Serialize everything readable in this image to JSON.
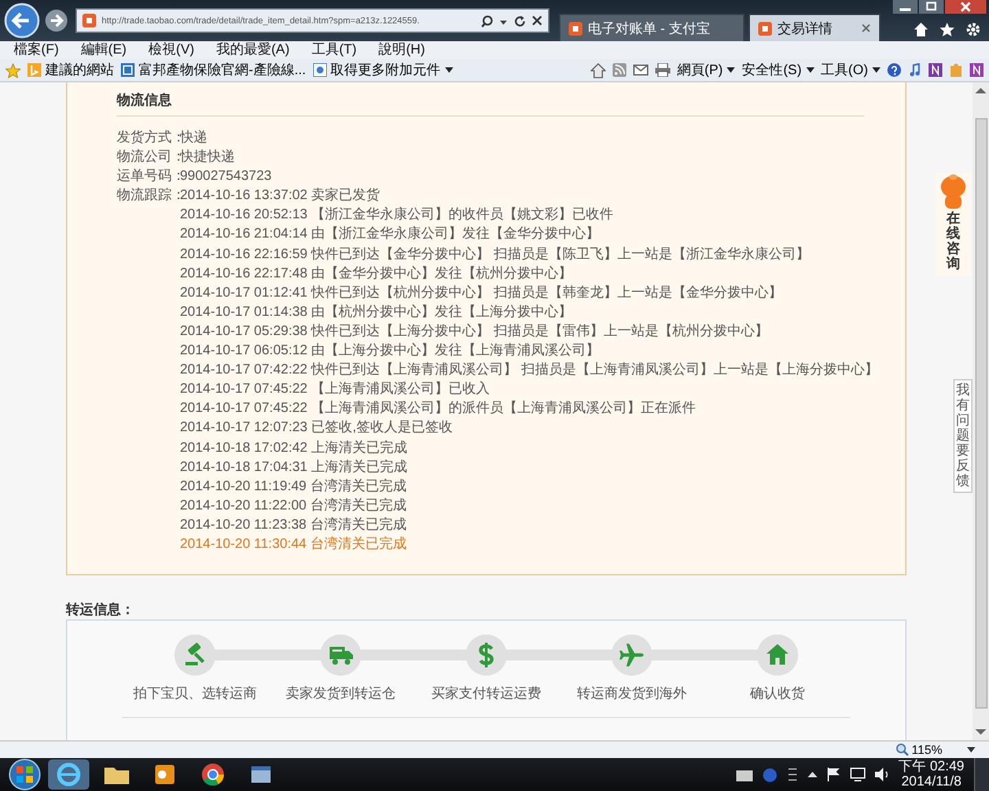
{
  "browser": {
    "address": "http://trade.taobao.com/trade/detail/trade_item_detail.htm?spm=a213z.1224559.",
    "tabs": [
      {
        "title": "电子对账单 - 支付宝",
        "selected": false
      },
      {
        "title": "交易详情",
        "selected": true
      }
    ],
    "menu": [
      "檔案(F)",
      "編輯(E)",
      "檢視(V)",
      "我的最愛(A)",
      "工具(T)",
      "說明(H)"
    ],
    "favorites": [
      "建議的網站",
      "富邦產物保險官網-產險線...",
      "取得更多附加元件"
    ],
    "commands": [
      "網頁(P)",
      "安全性(S)",
      "工具(O)"
    ]
  },
  "logistics": {
    "title": "物流信息",
    "fields": [
      {
        "label": "发货方式：",
        "value": "快递"
      },
      {
        "label": "物流公司：",
        "value": "快捷快递"
      },
      {
        "label": "运单号码：",
        "value": "990027543723"
      }
    ],
    "tracking_label": "物流跟踪：",
    "events": [
      {
        "text": "2014-10-16 13:37:02 卖家已发货",
        "latest": false
      },
      {
        "text": "2014-10-16 20:52:13 【浙江金华永康公司】的收件员【姚文彩】已收件",
        "latest": false
      },
      {
        "text": "2014-10-16 21:04:14 由【浙江金华永康公司】发往【金华分拨中心】",
        "latest": false
      },
      {
        "text": "2014-10-16 22:16:59 快件已到达【金华分拨中心】 扫描员是【陈卫飞】上一站是【浙江金华永康公司】",
        "latest": false
      },
      {
        "text": "2014-10-16 22:17:48 由【金华分拨中心】发往【杭州分拨中心】",
        "latest": false
      },
      {
        "text": "2014-10-17 01:12:41 快件已到达【杭州分拨中心】 扫描员是【韩奎龙】上一站是【金华分拨中心】",
        "latest": false
      },
      {
        "text": "2014-10-17 01:14:38 由【杭州分拨中心】发往【上海分拨中心】",
        "latest": false
      },
      {
        "text": "2014-10-17 05:29:38 快件已到达【上海分拨中心】 扫描员是【雷伟】上一站是【杭州分拨中心】",
        "latest": false
      },
      {
        "text": "2014-10-17 06:05:12 由【上海分拨中心】发往【上海青浦凤溪公司】",
        "latest": false
      },
      {
        "text": "2014-10-17 07:42:22 快件已到达【上海青浦凤溪公司】 扫描员是【上海青浦凤溪公司】上一站是【上海分拨中心】",
        "latest": false
      },
      {
        "text": "2014-10-17 07:45:22 【上海青浦凤溪公司】已收入",
        "latest": false
      },
      {
        "text": "2014-10-17 07:45:22 【上海青浦凤溪公司】的派件员【上海青浦凤溪公司】正在派件",
        "latest": false
      },
      {
        "text": "2014-10-17 12:07:23 已签收,签收人是已签收",
        "latest": false
      },
      {
        "text": "2014-10-18 17:02:42 上海清关已完成",
        "latest": false
      },
      {
        "text": "2014-10-18 17:04:31 上海清关已完成",
        "latest": false
      },
      {
        "text": "2014-10-20 11:19:49 台湾清关已完成",
        "latest": false
      },
      {
        "text": "2014-10-20 11:22:00 台湾清关已完成",
        "latest": false
      },
      {
        "text": "2014-10-20 11:23:38 台湾清关已完成",
        "latest": false
      },
      {
        "text": "2014-10-20 11:30:44 台湾清关已完成",
        "latest": true
      }
    ]
  },
  "transfer": {
    "title": "转运信息：",
    "steps": [
      {
        "label": "拍下宝贝、选转运商"
      },
      {
        "label": "卖家发货到转运仓"
      },
      {
        "label": "买家支付转运运费"
      },
      {
        "label": "转运商发货到海外"
      },
      {
        "label": "确认收货"
      }
    ]
  },
  "side": {
    "consult": "在线咨询",
    "feedback": "我有问题要反馈"
  },
  "status_bar": {
    "zoom": "115%"
  },
  "taskbar": {
    "time": "下午 02:49",
    "date": "2014/11/8"
  }
}
